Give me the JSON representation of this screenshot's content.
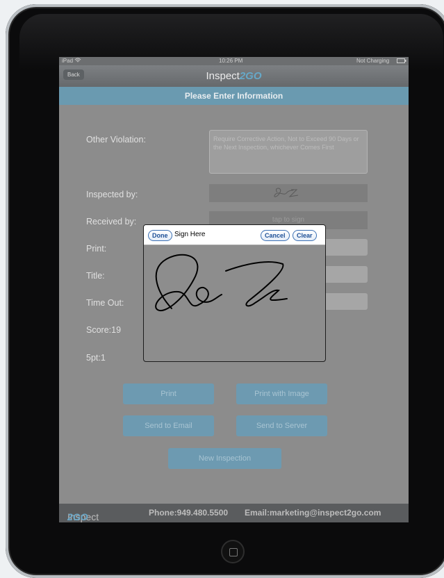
{
  "statusbar": {
    "device": "iPad",
    "wifi": "wifi-icon",
    "time": "10:26 PM",
    "battery": "Not Charging"
  },
  "navbar": {
    "back_label": "Back",
    "title_plain": "Inspect",
    "title_accent": "2GO"
  },
  "infobar": {
    "title": "Please Enter Information"
  },
  "form": {
    "other_violation_label": "Other Violation:",
    "other_violation_text": "Require Corrective Action, Not to Exceed 90 Days or the Next Inspection, whichever Comes First",
    "inspected_by_label": "Inspected by:",
    "received_by_label": "Received by:",
    "received_by_placeholder": "tap to sign",
    "print_label": "Print:",
    "title_label": "Title:",
    "time_out_label": "Time Out:",
    "score_label": "Score:19",
    "fivept_label": "5pt:1"
  },
  "buttons": {
    "print": "Print",
    "print_image": "Print  with Image",
    "send_email": "Send to Email",
    "send_server": "Send to Server",
    "new_inspection": "New Inspection"
  },
  "footer": {
    "brand_plain": "Inspect",
    "brand_accent": "2GO",
    "phone": "Phone:949.480.5500",
    "email": "Email:marketing@inspect2go.com"
  },
  "popup": {
    "done": "Done",
    "title": "Sign Here",
    "cancel": "Cancel",
    "clear": "Clear"
  }
}
